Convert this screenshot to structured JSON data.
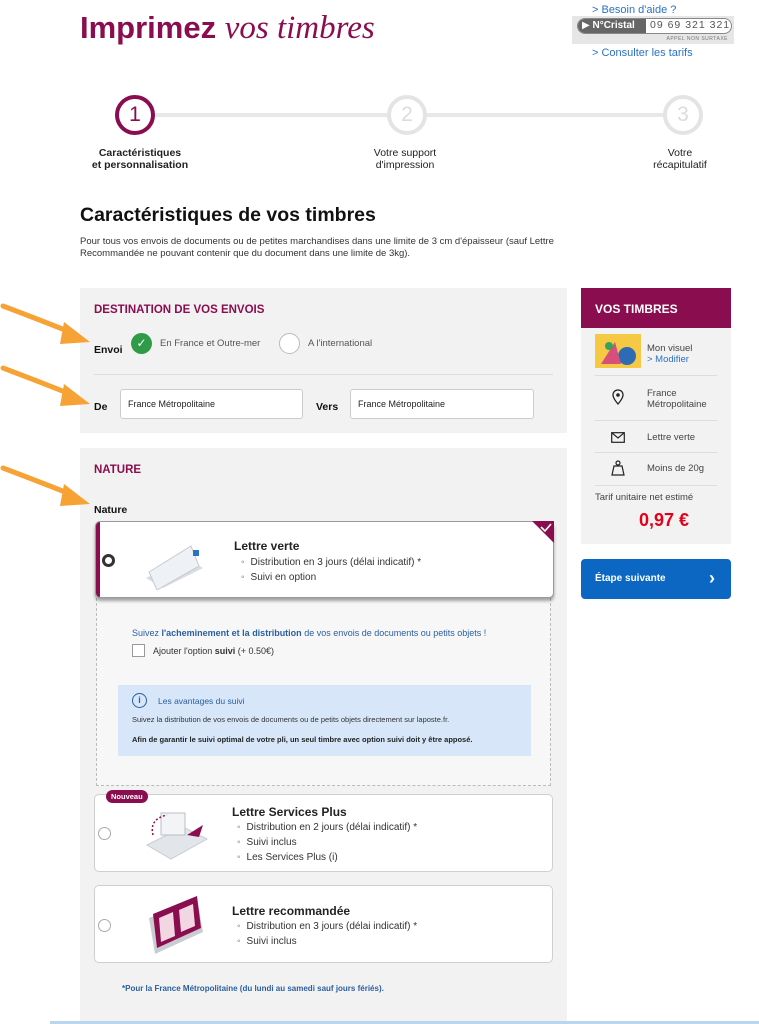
{
  "header": {
    "title_bold": "Imprimez",
    "title_italic": "vos timbres",
    "help_link": "> Besoin d'aide ?",
    "cristal_label": "N°Cristal",
    "cristal_number": "09 69 321 321",
    "cristal_note": "APPEL NON SURTAXE",
    "tarifs_link": "> Consulter les tarifs"
  },
  "steps": [
    {
      "number": "1",
      "label_line1": "Caractéristiques",
      "label_line2": "et personnalisation"
    },
    {
      "number": "2",
      "label_line1": "Votre support",
      "label_line2": "d'impression"
    },
    {
      "number": "3",
      "label_line1": "Votre",
      "label_line2": "récapitulatif"
    }
  ],
  "page": {
    "heading": "Caractéristiques de vos timbres",
    "intro": "Pour tous vos envois de documents ou de petites marchandises dans une limite de 3 cm d'épaisseur (sauf Lettre Recommandée ne pouvant contenir que du document dans une limite de 3kg)."
  },
  "destination": {
    "title": "DESTINATION DE VOS ENVOIS",
    "envoi_label": "Envoi",
    "option_france": "En France et Outre-mer",
    "option_international": "A l'international",
    "selected": "En France et Outre-mer",
    "de_label": "De",
    "de_value": "France Métropolitaine",
    "vers_label": "Vers",
    "vers_value": "France Métropolitaine"
  },
  "nature": {
    "title": "NATURE",
    "label": "Nature",
    "lettre_verte": {
      "title": "Lettre verte",
      "bullets": [
        "Distribution en 3 jours (délai indicatif) *",
        "Suivi en option"
      ]
    },
    "suivi_box": {
      "text_pre": "Suivez ",
      "text_bold": "l'acheminement et la distribution",
      "text_post": " de vos envois de documents ou petits objets !",
      "checkbox_pre": "Ajouter l'option ",
      "checkbox_bold": "suivi",
      "checkbox_post": " (+ 0.50€)",
      "info_title": "Les avantages du suivi",
      "info_text": "Suivez la distribution de vos envois de documents ou de petits objets directement sur laposte.fr.",
      "info_bold": "Afin de garantir le suivi optimal de votre pli, un seul timbre avec option suivi doit y être apposé."
    },
    "services_plus": {
      "badge": "Nouveau",
      "title": "Lettre Services Plus",
      "bullets": [
        "Distribution en 2 jours (délai indicatif) *",
        "Suivi inclus",
        "Les Services Plus (i)"
      ]
    },
    "recommandee": {
      "title": "Lettre recommandée",
      "bullets": [
        "Distribution en 3 jours (délai indicatif) *",
        "Suivi inclus"
      ]
    },
    "footnote": "*Pour la France Métropolitaine (du lundi au samedi sauf jours fériés)."
  },
  "sidebar": {
    "title": "VOS TIMBRES",
    "visuel": "Mon visuel",
    "modifier": "> Modifier",
    "destination_line1": "France",
    "destination_line2": "Métropolitaine",
    "type": "Lettre verte",
    "poids": "Moins de 20g",
    "tarif_label": "Tarif unitaire net estimé",
    "price": "0,97 €",
    "next_button": "Étape suivante"
  },
  "colors": {
    "brand": "#8a0e4f",
    "button": "#0b67c2",
    "selected_green": "#2e9b48",
    "price_red": "#e2001a",
    "annotation_arrow": "#f7a234"
  }
}
